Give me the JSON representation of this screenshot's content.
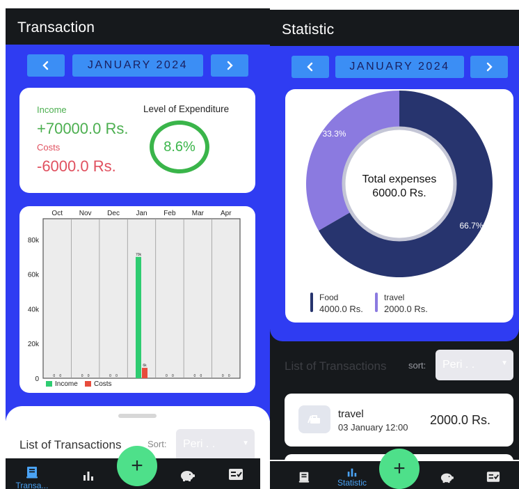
{
  "transaction": {
    "title": "Transaction",
    "month_label": "JANUARY 2024",
    "prev_icon": "chevron-left",
    "next_icon": "chevron-right",
    "income_label": "Income",
    "income_value": "+70000.0 Rs.",
    "costs_label": "Costs",
    "costs_value": "-6000.0 Rs.",
    "expenditure_label": "Level of Expenditure",
    "expenditure_value": "8.6%",
    "list_title": "List of Transactions",
    "sort_label": "Sort:",
    "sort_value": "Peri . .",
    "nav_transactions_label": "Transa...",
    "colors": {
      "income": "#4caf50",
      "costs": "#e0505f",
      "accent": "#2f3cf2"
    }
  },
  "chart_data": [
    {
      "type": "bar",
      "categories": [
        "Oct",
        "Nov",
        "Dec",
        "Jan",
        "Feb",
        "Mar",
        "Apr"
      ],
      "series": [
        {
          "name": "Income",
          "values": [
            0,
            0,
            0,
            70000,
            0,
            0,
            0
          ],
          "color": "#2ecc71"
        },
        {
          "name": "Costs",
          "values": [
            0,
            0,
            0,
            6000,
            0,
            0,
            0
          ],
          "color": "#e74c3c"
        }
      ],
      "value_labels": {
        "Income": [
          "0",
          "0",
          "0",
          "70k",
          "0",
          "0",
          "0"
        ],
        "Costs": [
          "0",
          "0",
          "0",
          "6k",
          "0",
          "0",
          "0"
        ]
      },
      "yticks": [
        "0",
        "20k",
        "40k",
        "60k",
        "80k"
      ],
      "ylim": [
        0,
        92000
      ],
      "legend": "bottom-left",
      "grid": true
    },
    {
      "type": "pie",
      "donut": true,
      "categories": [
        "Food",
        "travel"
      ],
      "values": [
        4000,
        2000
      ],
      "percent_labels": [
        "66.7%",
        "33.3%"
      ],
      "colors": [
        "#27346e",
        "#8b7ae0"
      ],
      "center_text": [
        "Total expenses",
        "6000.0 Rs."
      ],
      "legend": "bottom"
    }
  ],
  "statistic": {
    "title": "Statistic",
    "month_label": "JANUARY 2024",
    "legend": [
      {
        "name": "Food",
        "amount": "4000.0 Rs.",
        "color": "#27346e"
      },
      {
        "name": "travel",
        "amount": "2000.0 Rs.",
        "color": "#8b7ae0"
      }
    ],
    "list_title": "List of Transactions",
    "sort_label": "sort:",
    "sort_value": "Peri . .",
    "transaction": {
      "name": "travel",
      "date": "03 January 12:00",
      "amount": "2000.0 Rs.",
      "icon": "travel-icon"
    },
    "nav_statistic_label": "Statistic"
  },
  "nav_icons": [
    "receipt-icon",
    "bar-chart-icon",
    "plus-icon",
    "piggy-bank-icon",
    "checklist-icon"
  ]
}
